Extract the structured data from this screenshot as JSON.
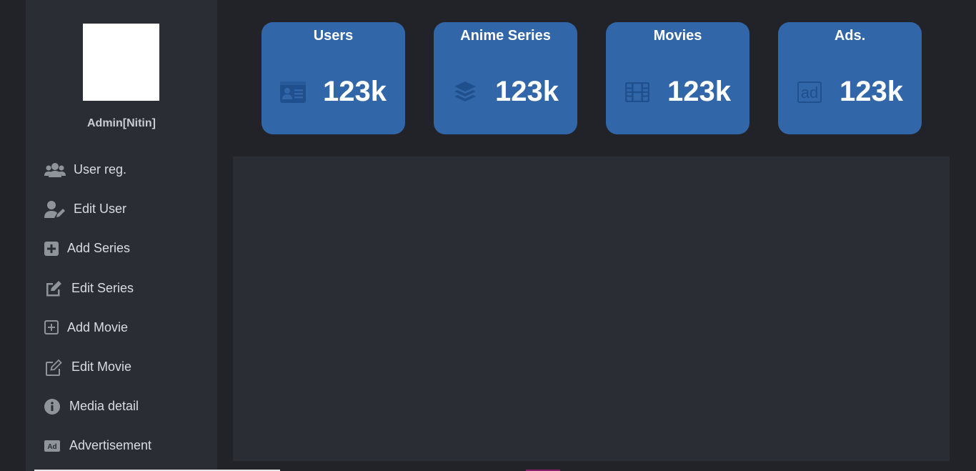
{
  "sidebar": {
    "admin_name": "Admin[Nitin]",
    "items": [
      {
        "label": "User reg.",
        "icon": "users-icon"
      },
      {
        "label": "Edit User",
        "icon": "user-edit-icon"
      },
      {
        "label": "Add Series",
        "icon": "plus-square-icon"
      },
      {
        "label": "Edit Series",
        "icon": "edit-square-icon"
      },
      {
        "label": "Add Movie",
        "icon": "plus-square-outline-icon"
      },
      {
        "label": "Edit Movie",
        "icon": "edit-square-outline-icon"
      },
      {
        "label": "Media detail",
        "icon": "info-circle-icon"
      },
      {
        "label": "Advertisement",
        "icon": "ad-icon"
      }
    ]
  },
  "cards": [
    {
      "title": "Users",
      "value": "123k",
      "icon": "id-card-icon"
    },
    {
      "title": "Anime Series",
      "value": "123k",
      "icon": "layers-icon"
    },
    {
      "title": "Movies",
      "value": "123k",
      "icon": "film-icon"
    },
    {
      "title": "Ads.",
      "value": "123k",
      "icon": "ad-icon"
    }
  ],
  "colors": {
    "background": "#222328",
    "panel": "#2a2d33",
    "card": "#3166a8",
    "card_icon": "#1f4f8c",
    "sidebar_icon": "#8f949b"
  }
}
